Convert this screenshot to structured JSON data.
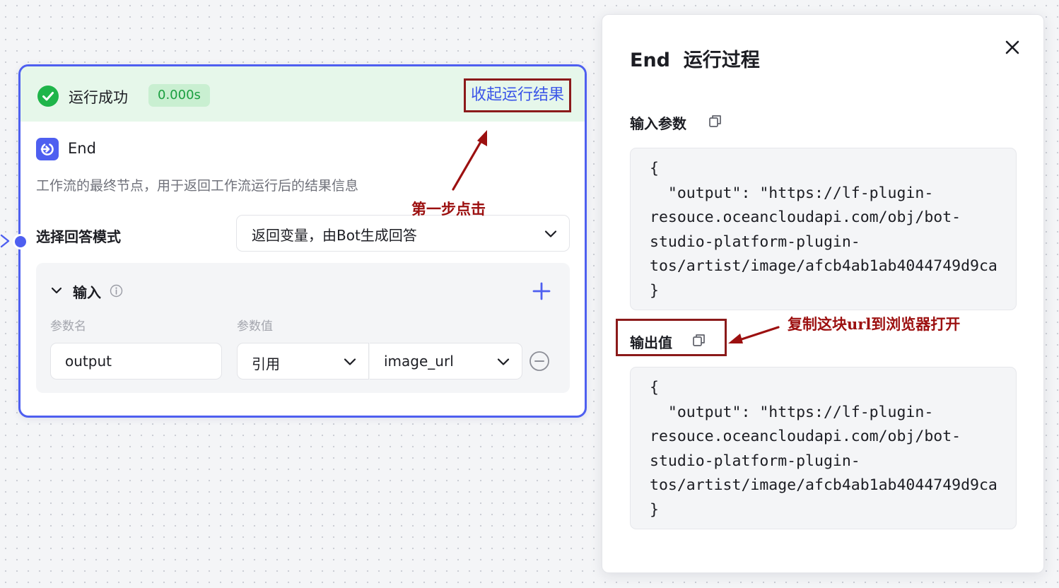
{
  "node": {
    "status_text": "运行成功",
    "duration": "0.000s",
    "collapse_link": "收起运行结果",
    "title": "End",
    "description": "工作流的最终节点，用于返回工作流运行后的结果信息",
    "answer_mode": {
      "label": "选择回答模式",
      "value": "返回变量，由Bot生成回答"
    },
    "inputs": {
      "title": "输入",
      "col_name": "参数名",
      "col_value": "参数值",
      "param_name": "output",
      "ref_type": "引用",
      "ref_variable": "image_url"
    }
  },
  "annotations": {
    "step1": "第一步点击",
    "step2": "复制这块url到浏览器打开"
  },
  "panel": {
    "title": "End  运行过程",
    "input_label": "输入参数",
    "input_code": "{\n  \"output\": \"https://lf-plugin-\nresouce.oceancloudapi.com/obj/bot-\nstudio-platform-plugin-\ntos/artist/image/afcb4ab1ab4044749d9ca\n}",
    "output_label": "输出值",
    "output_code": "{\n  \"output\": \"https://lf-plugin-\nresouce.oceancloudapi.com/obj/bot-\nstudio-platform-plugin-\ntos/artist/image/afcb4ab1ab4044749d9ca\n}"
  },
  "colors": {
    "accent": "#4e5ff0",
    "success": "#1fb54a",
    "annotation": "#9c1010"
  }
}
